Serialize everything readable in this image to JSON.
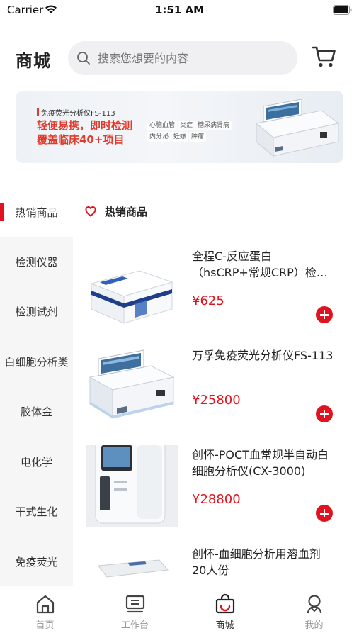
{
  "status_bar": {
    "carrier": "Carrier",
    "time": "1:51 AM"
  },
  "header": {
    "title": "商城",
    "search_placeholder": "搜索您想要的内容"
  },
  "banner": {
    "subtitle": "免疫荧光分析仪FS-113",
    "headline_1": "轻便易携，即时检测",
    "headline_2": "覆盖临床40+项目",
    "tags": [
      "心脑血管",
      "炎症",
      "糖尿病肾病",
      "内分泌",
      "妊娠",
      "肿瘤"
    ]
  },
  "categories": [
    {
      "label": "热销商品",
      "active": true
    },
    {
      "label": "检测仪器"
    },
    {
      "label": "检测试剂"
    },
    {
      "label": "白细胞分析类"
    },
    {
      "label": "胶体金"
    },
    {
      "label": "电化学"
    },
    {
      "label": "干式生化"
    },
    {
      "label": "免疫荧光"
    }
  ],
  "section": {
    "title": "热销商品"
  },
  "products": [
    {
      "name": "全程C-反应蛋白（hsCRP+常规CRP）检测试剂盒",
      "price": "¥625"
    },
    {
      "name": "万孚免疫荧光分析仪FS-113",
      "price": "¥25800"
    },
    {
      "name": "创怀-POCT血常规半自动白细胞分析仪(CX-3000)",
      "price": "¥28800"
    },
    {
      "name": "创怀-血细胞分析用溶血剂20人份",
      "price": ""
    }
  ],
  "tabs": [
    {
      "label": "首页"
    },
    {
      "label": "工作台"
    },
    {
      "label": "商城",
      "active": true
    },
    {
      "label": "我的"
    }
  ],
  "colors": {
    "accent": "#e0131f",
    "banner_text": "#e23b2e",
    "nav_bg": "#f6f6f6"
  }
}
